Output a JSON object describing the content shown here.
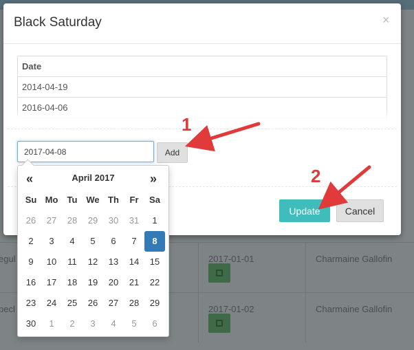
{
  "modal": {
    "title": "Black Saturday",
    "close_glyph": "×",
    "table": {
      "header": "Date",
      "rows": [
        "2014-04-19",
        "2016-04-06"
      ]
    },
    "date_input": {
      "value": "2017-04-08"
    },
    "add_label": "Add",
    "update_label": "Update",
    "cancel_label": "Cancel"
  },
  "datepicker": {
    "month_label": "April 2017",
    "prev_glyph": "«",
    "next_glyph": "»",
    "days_of_week": [
      "Su",
      "Mo",
      "Tu",
      "We",
      "Th",
      "Fr",
      "Sa"
    ],
    "weeks": [
      [
        "26",
        "27",
        "28",
        "29",
        "30",
        "31",
        "1"
      ],
      [
        "2",
        "3",
        "4",
        "5",
        "6",
        "7",
        "8"
      ],
      [
        "9",
        "10",
        "11",
        "12",
        "13",
        "14",
        "15"
      ],
      [
        "16",
        "17",
        "18",
        "19",
        "20",
        "21",
        "22"
      ],
      [
        "23",
        "24",
        "25",
        "26",
        "27",
        "28",
        "29"
      ],
      [
        "30",
        "1",
        "2",
        "3",
        "4",
        "5",
        "6"
      ]
    ],
    "selected": "8"
  },
  "background": {
    "partial_labels": [
      "egul",
      "pecl"
    ],
    "rows": [
      {
        "date": "2017-01-01",
        "name": "Charmaine Gallofin"
      },
      {
        "date": "2017-01-02",
        "name": "Charmaine Gallofin"
      }
    ]
  },
  "annotations": {
    "step1": "1",
    "step2": "2",
    "color": "#e03a3a"
  },
  "colors": {
    "accent_teal": "#3fbdbd",
    "selected_blue": "#337ab7"
  }
}
